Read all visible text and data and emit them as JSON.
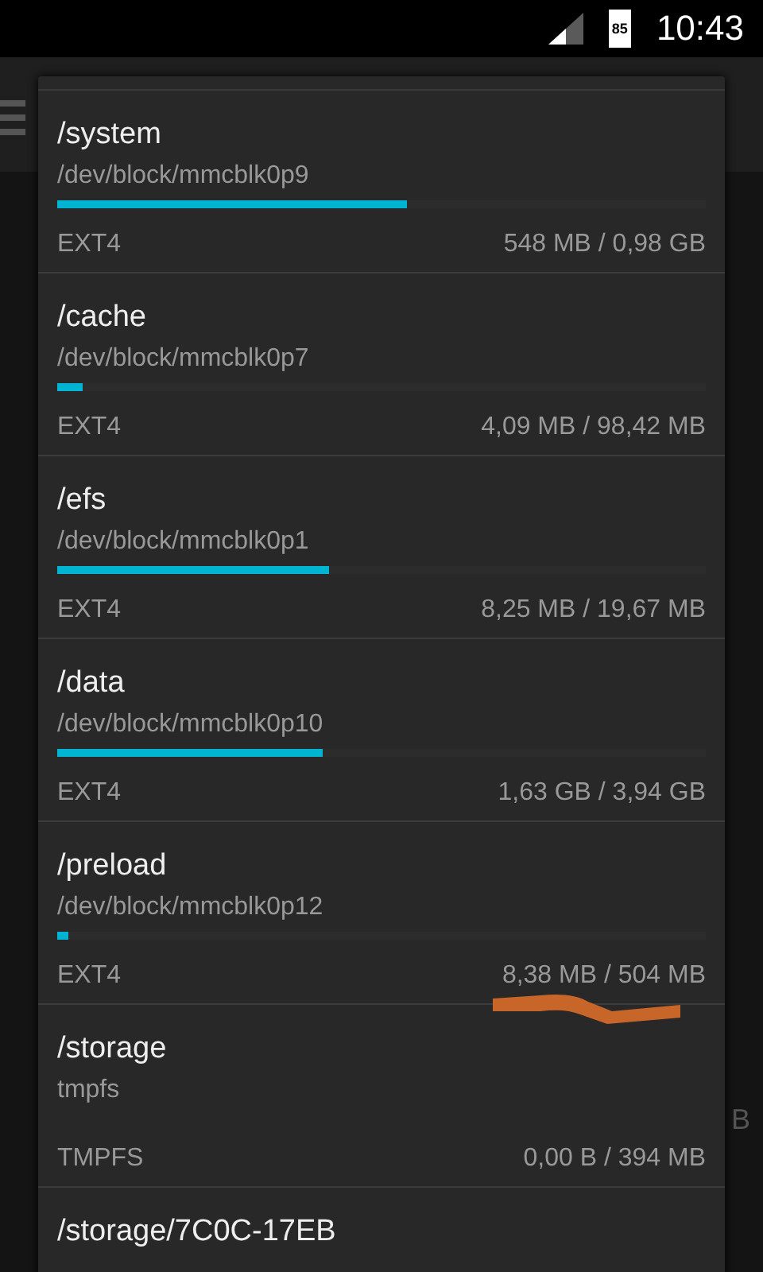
{
  "status_bar": {
    "battery": "85",
    "time": "10:43"
  },
  "background": {
    "partial_text": "B"
  },
  "mounts": [
    {
      "path": "/system",
      "device": "/dev/block/mmcblk0p9",
      "level": 0.54,
      "fs": "EXT4",
      "usage": "548 MB / 0,98 GB"
    },
    {
      "path": "/cache",
      "device": "/dev/block/mmcblk0p7",
      "level": 0.04,
      "fs": "EXT4",
      "usage": "4,09 MB / 98,42 MB"
    },
    {
      "path": "/efs",
      "device": "/dev/block/mmcblk0p1",
      "level": 0.42,
      "fs": "EXT4",
      "usage": "8,25 MB / 19,67 MB"
    },
    {
      "path": "/data",
      "device": "/dev/block/mmcblk0p10",
      "level": 0.41,
      "fs": "EXT4",
      "usage": "1,63 GB / 3,94 GB"
    },
    {
      "path": "/preload",
      "device": "/dev/block/mmcblk0p12",
      "level": 0.016,
      "fs": "EXT4",
      "usage": "8,38 MB / 504 MB"
    },
    {
      "path": "/storage",
      "device": "tmpfs",
      "fs": "TMPFS",
      "usage": "0,00 B / 394 MB"
    },
    {
      "path": "/storage/7C0C-17EB"
    }
  ]
}
